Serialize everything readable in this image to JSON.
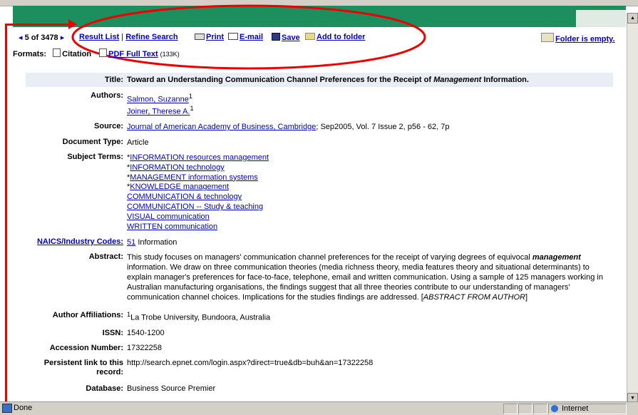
{
  "nav": {
    "prev_symbol": "◂",
    "position": "5 of 3478",
    "next_symbol": "▸",
    "result_list": "Result List",
    "separator": "|",
    "refine_search": "Refine Search",
    "print": "Print",
    "email": "E-mail",
    "save": "Save",
    "add_to_folder": "Add to folder",
    "folder_status": "Folder is empty."
  },
  "formats": {
    "label": "Formats:",
    "citation": "Citation",
    "pdf": "PDF Full Text",
    "pdf_size": "(133K)"
  },
  "record": {
    "title_label": "Title:",
    "title_pre": "Toward an Understanding Communication Channel Preferences for the Receipt of ",
    "title_em": "Management",
    "title_post": " Information.",
    "authors_label": "Authors:",
    "author1": "Salmon, Suzanne",
    "author2": "Joiner, Therese A.",
    "author_sup": "1",
    "source_label": "Source:",
    "source_link": "Journal of American Academy of Business, Cambridge",
    "source_rest": "; Sep2005, Vol. 7 Issue 2, p56 - 62, 7p",
    "doctype_label": "Document Type:",
    "doctype": "Article",
    "subjects_label": "Subject Terms:",
    "subjects": [
      {
        "prefix": "*",
        "text": "INFORMATION resources management"
      },
      {
        "prefix": "*",
        "text": "INFORMATION technology"
      },
      {
        "prefix": "*",
        "text": "MANAGEMENT information systems"
      },
      {
        "prefix": "*",
        "text": "KNOWLEDGE management"
      },
      {
        "prefix": "",
        "text": "COMMUNICATION & technology"
      },
      {
        "prefix": "",
        "text": "COMMUNICATION -- Study & teaching"
      },
      {
        "prefix": "",
        "text": "VISUAL communication"
      },
      {
        "prefix": "",
        "text": "WRITTEN communication"
      }
    ],
    "naics_label": "NAICS/Industry Codes:",
    "naics_code": "51",
    "naics_text": "Information",
    "abstract_label": "Abstract:",
    "abstract_pre": "This study focuses on managers' communication channel preferences for the receipt of varying degrees of equivocal ",
    "abstract_em": "management",
    "abstract_mid": " information. We draw on three communication theories (media richness theory, media features theory and situational determinants) to explain manager's preferences for face-to-face, telephone, email and written communication. Using a sample of 125 managers working in Australian manufacturing organisations, the findings suggest that all three theories contribute to our understanding of managers' communication channel choices. Implications for the studies findings are addressed. [",
    "abstract_tail": "ABSTRACT FROM AUTHOR",
    "abstract_close": "]",
    "affil_label": "Author Affiliations:",
    "affil_sup": "1",
    "affil": "La Trobe University, Bundoora, Australia",
    "issn_label": "ISSN:",
    "issn": "1540-1200",
    "accession_label": "Accession Number:",
    "accession": "17322258",
    "persistent_label_1": "Persistent link to this",
    "persistent_label_2": "record:",
    "persistent": "http://search.epnet.com/login.aspx?direct=true&db=buh&an=17322258",
    "database_label": "Database:",
    "database": "Business Source Premier"
  },
  "status": {
    "left": "Done",
    "zone": "Internet"
  },
  "colors": {
    "header_green": "#1d8f5f",
    "link": "#0000cc",
    "annotation_red": "#e00000",
    "title_bg": "#e9edf5"
  }
}
